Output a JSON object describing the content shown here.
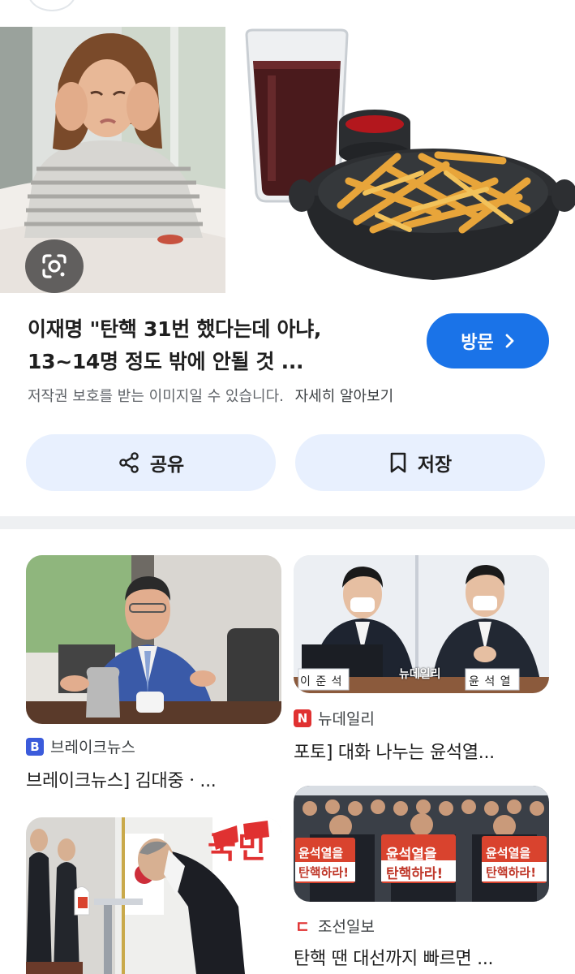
{
  "preview": {
    "title_line1": "이재명 \"탄핵 31번 했다는데 아냐,",
    "title_line2": "13~14명 정도 밖에 안될 것 ...",
    "visit_label": "방문",
    "copyright_text": "저작권 보호를 받는 이미지일 수 있습니다.",
    "learn_more": "자세히 알아보기",
    "share_label": "공유",
    "save_label": "저장",
    "accent": "#1a73e8",
    "button_bg": "#e8f0fe"
  },
  "related": [
    {
      "source": "브레이크뉴스",
      "source_logo": "B",
      "source_color": "#3b5bdb",
      "title": "브레이크뉴스] 김대중ㆍ..."
    },
    {
      "source": "뉴데일리",
      "source_logo": "N",
      "source_color": "#e03131",
      "title": "포토] 대화 나누는 윤석열...",
      "nameplate_left": "이 준 석",
      "nameplate_right": "윤 석 열",
      "watermark": "뉴데일리"
    },
    {
      "source": "조선일보",
      "source_logo": "ㄷ",
      "source_color": "#e03131",
      "title": "탄핵 땐 대선까지 빠르면 ...",
      "sign_text_1": "윤석열을",
      "sign_text_2": "탄핵하라!"
    },
    {
      "brand_text": "국민"
    }
  ]
}
